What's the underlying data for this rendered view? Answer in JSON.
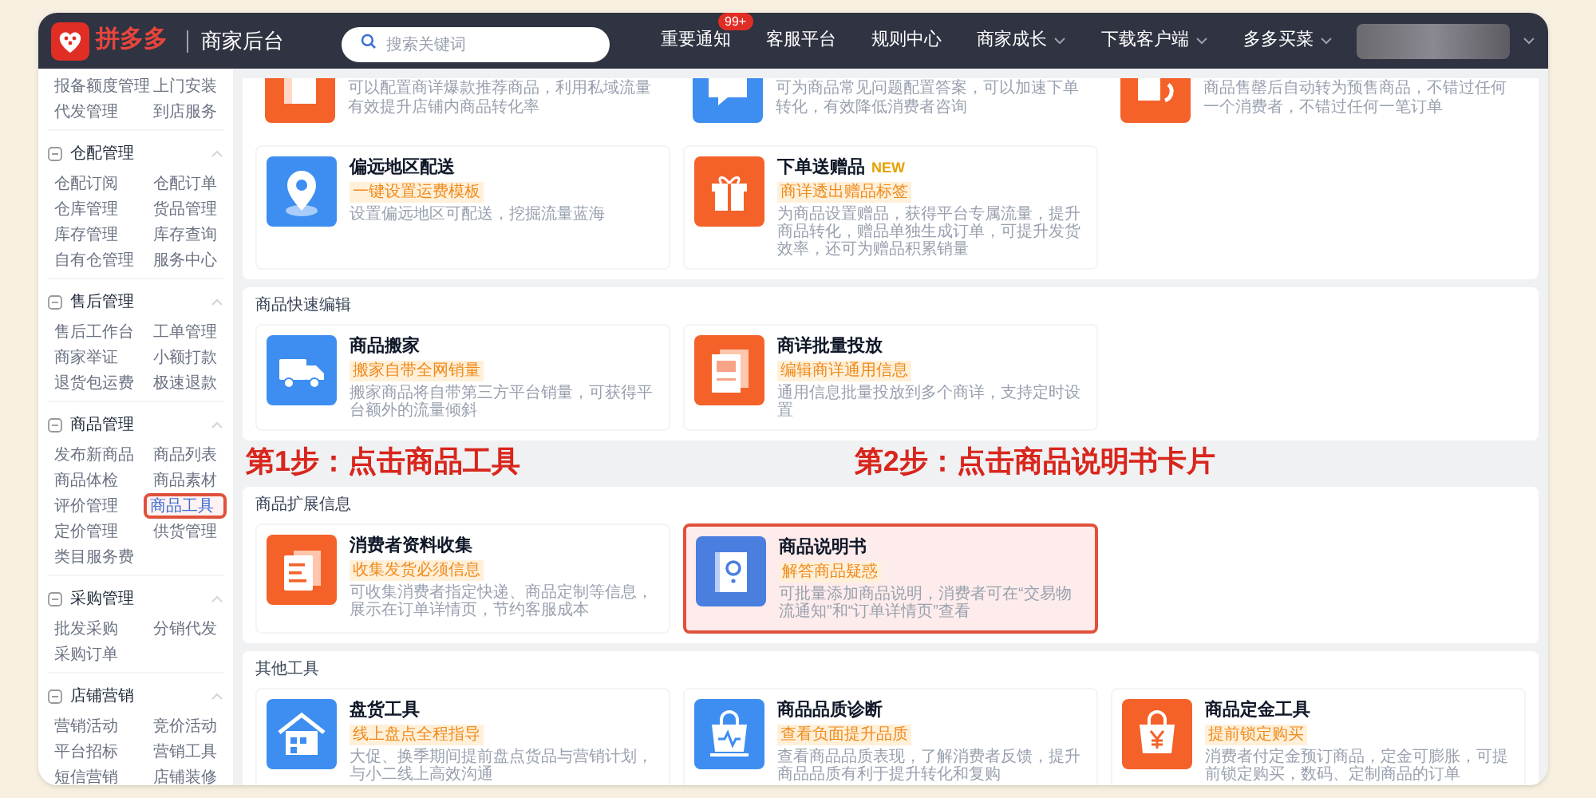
{
  "header": {
    "logo": "拼多多",
    "subtitle": "商家后台",
    "search": {
      "placeholder": "搜索关键词"
    },
    "nav": [
      {
        "label": "重要通知",
        "badge": "99+",
        "dropdown": false
      },
      {
        "label": "客服平台",
        "dropdown": false
      },
      {
        "label": "规则中心",
        "dropdown": false
      },
      {
        "label": "商家成长",
        "dropdown": true
      },
      {
        "label": "下载客户端",
        "dropdown": true
      },
      {
        "label": "多多买菜",
        "dropdown": true
      }
    ]
  },
  "sidebar": {
    "groups": [
      {
        "items": [
          {
            "label": "报备额度管理",
            "selected": false
          },
          {
            "label": "上门安装",
            "selected": false
          },
          {
            "label": "代发管理",
            "selected": false
          },
          {
            "label": "到店服务",
            "selected": false
          }
        ]
      },
      {
        "title": "仓配管理",
        "expanded": true,
        "items": [
          {
            "label": "仓配订阅",
            "selected": false
          },
          {
            "label": "仓配订单",
            "selected": false
          },
          {
            "label": "仓库管理",
            "selected": false
          },
          {
            "label": "货品管理",
            "selected": false
          },
          {
            "label": "库存管理",
            "selected": false
          },
          {
            "label": "库存查询",
            "selected": false
          },
          {
            "label": "自有仓管理",
            "selected": false
          },
          {
            "label": "服务中心",
            "selected": false
          }
        ]
      },
      {
        "title": "售后管理",
        "expanded": true,
        "items": [
          {
            "label": "售后工作台",
            "selected": false
          },
          {
            "label": "工单管理",
            "selected": false
          },
          {
            "label": "商家举证",
            "selected": false
          },
          {
            "label": "小额打款",
            "selected": false
          },
          {
            "label": "退货包运费",
            "selected": false
          },
          {
            "label": "极速退款",
            "selected": false
          }
        ]
      },
      {
        "title": "商品管理",
        "expanded": true,
        "items": [
          {
            "label": "发布新商品",
            "selected": false
          },
          {
            "label": "商品列表",
            "selected": false
          },
          {
            "label": "商品体检",
            "selected": false
          },
          {
            "label": "商品素材",
            "selected": false
          },
          {
            "label": "评价管理",
            "selected": false
          },
          {
            "label": "商品工具",
            "selected": true
          },
          {
            "label": "定价管理",
            "selected": false
          },
          {
            "label": "供货管理",
            "selected": false
          },
          {
            "label": "类目服务费",
            "selected": false
          }
        ]
      },
      {
        "title": "采购管理",
        "expanded": true,
        "items": [
          {
            "label": "批发采购",
            "selected": false
          },
          {
            "label": "分销代发",
            "selected": false
          },
          {
            "label": "采购订单",
            "selected": false
          }
        ]
      },
      {
        "title": "店铺营销",
        "expanded": true,
        "items": [
          {
            "label": "营销活动",
            "selected": false
          },
          {
            "label": "竞价活动",
            "selected": false
          },
          {
            "label": "平台招标",
            "selected": false
          },
          {
            "label": "营销工具",
            "selected": false
          },
          {
            "label": "短信营销",
            "selected": false
          },
          {
            "label": "店铺装修",
            "selected": false
          }
        ]
      }
    ]
  },
  "sections": [
    {
      "cards": [
        {
          "kind": "cut",
          "description": "可以配置商详爆款推荐商品，利用私域流量有效提升店铺内商品转化率"
        },
        {
          "kind": "cut",
          "description": "可为商品常见问题配置答案，可以加速下单转化，有效降低消费者咨询"
        },
        {
          "kind": "cut",
          "description": "商品售罄后自动转为预售商品，不错过任何一个消费者，不错过任何一笔订单"
        },
        {
          "kind": "full",
          "title": "偏远地区配送",
          "tag": "一键设置运费模板",
          "description": "设置偏远地区可配送，挖掘流量蓝海",
          "highlighted": false
        },
        {
          "kind": "full",
          "title": "下单送赠品",
          "new_badge": "NEW",
          "tag": "商详透出赠品标签",
          "description": "为商品设置赠品，获得平台专属流量，提升商品转化，赠品单独生成订单，可提升发货效率，还可为赠品积累销量",
          "highlighted": false
        }
      ]
    },
    {
      "title": "商品快速编辑",
      "cards": [
        {
          "kind": "full",
          "title": "商品搬家",
          "tag": "搬家自带全网销量",
          "description": "搬家商品将自带第三方平台销量，可获得平台额外的流量倾斜",
          "highlighted": false
        },
        {
          "kind": "full",
          "title": "商详批量投放",
          "tag": "编辑商详通用信息",
          "description": "通用信息批量投放到多个商详，支持定时设置",
          "highlighted": false
        }
      ]
    },
    {
      "title": "商品扩展信息",
      "cards": [
        {
          "kind": "full",
          "title": "消费者资料收集",
          "tag": "收集发货必须信息",
          "description": "可收集消费者指定快递、商品定制等信息，展示在订单详情页，节约客服成本",
          "highlighted": false
        },
        {
          "kind": "full",
          "title": "商品说明书",
          "tag": "解答商品疑惑",
          "description": "可批量添加商品说明，消费者可在“交易物流通知”和“订单详情页”查看",
          "highlighted": true
        }
      ]
    },
    {
      "title": "其他工具",
      "cards": [
        {
          "kind": "full",
          "title": "盘货工具",
          "tag": "线上盘点全程指导",
          "description": "大促、换季期间提前盘点货品与营销计划，与小二线上高效沟通",
          "highlighted": false
        },
        {
          "kind": "full",
          "title": "商品品质诊断",
          "tag": "查看负面提升品质",
          "description": "查看商品品质表现，了解消费者反馈，提升商品品质有利于提升转化和复购",
          "highlighted": false
        },
        {
          "kind": "full",
          "title": "商品定金工具",
          "tag": "提前锁定购买",
          "description": "消费者付定金预订商品，定金可膨胀，可提前锁定购买，数码、定制商品的订单",
          "highlighted": false
        }
      ]
    }
  ],
  "annotations": [
    {
      "text": "第1步：点击商品工具"
    },
    {
      "text": "第2步：点击商品说明书卡片"
    }
  ]
}
